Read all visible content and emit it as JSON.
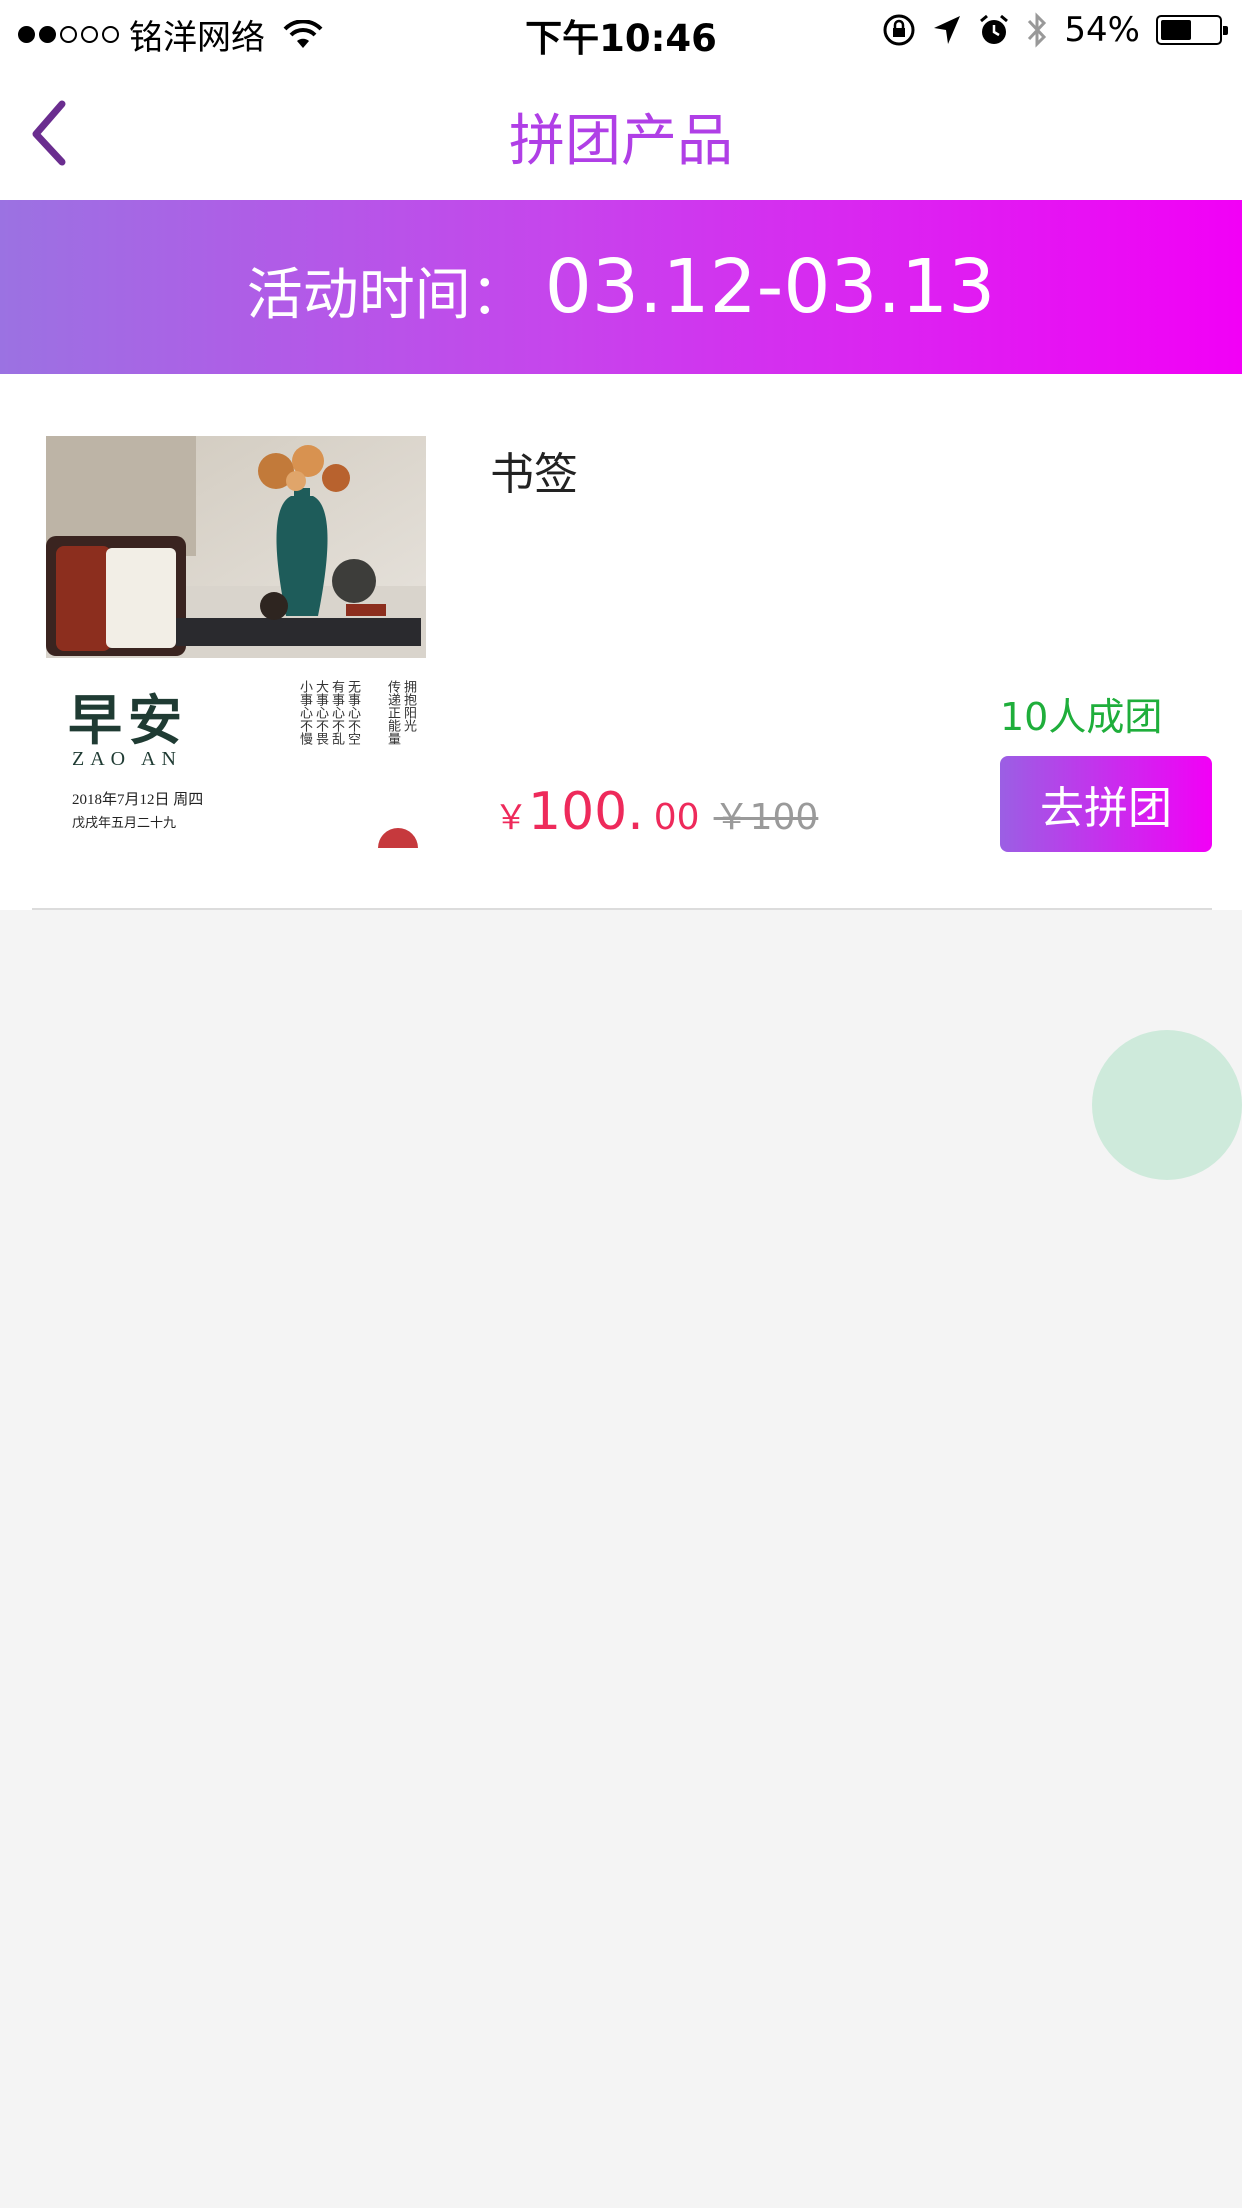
{
  "status_bar": {
    "carrier": "铭洋网络",
    "time": "下午10:46",
    "battery": "54%",
    "icons": [
      "signal-dots-icon",
      "wifi-icon",
      "orientation-lock-icon",
      "location-arrow-icon",
      "alarm-icon",
      "bluetooth-icon",
      "battery-icon"
    ]
  },
  "nav": {
    "title": "拼团产品",
    "back_icon": "chevron-left-icon"
  },
  "banner": {
    "label": "活动时间：",
    "dates": "03.12-03.13"
  },
  "products": [
    {
      "name": "书签",
      "image": {
        "title_zh": "早安",
        "title_en": "ZAO AN",
        "date": "2018年7月12日 周四",
        "lunar": "戊戌年五月二十九"
      },
      "price_symbol": "￥",
      "price_int": "100.",
      "price_dec": "00",
      "original_price": "￥100",
      "group_size": "10人成团",
      "button_label": "去拼团"
    }
  ],
  "colors": {
    "title": "#b03fe6",
    "banner_start": "#9b72e2",
    "banner_end": "#f200f6",
    "price": "#ee2a5b",
    "group_text": "#1fae3b",
    "background": "#f4f4f4",
    "fab": "#ceeadb"
  }
}
